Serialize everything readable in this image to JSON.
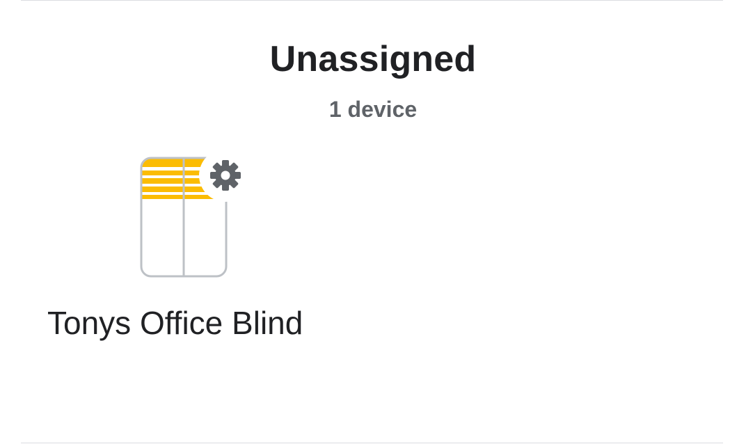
{
  "section": {
    "title": "Unassigned",
    "subtitle": "1 device"
  },
  "devices": [
    {
      "name": "Tonys Office Blind",
      "icon": "window-blind-icon",
      "badge_icon": "gear-icon"
    }
  ],
  "colors": {
    "blind_slats": "#fbbc04",
    "frame": "#bdc1c6",
    "gear": "#5f6368",
    "title_text": "#202124",
    "subtitle_text": "#5f6368"
  }
}
